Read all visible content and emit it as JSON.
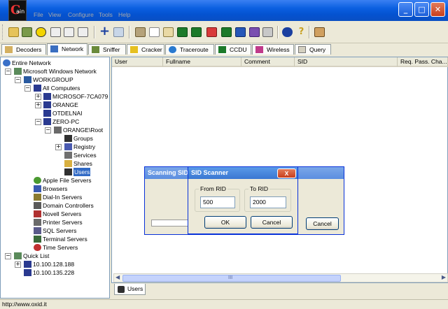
{
  "app": {
    "icon_letter": "C",
    "icon_text": "ain"
  },
  "menu": [
    "File",
    "View",
    "Configure",
    "Tools",
    "Help"
  ],
  "window_buttons": {
    "min": "_",
    "max": "□",
    "close": "✕"
  },
  "toolbar_icons": [
    "open-folder-icon",
    "sniffer-card-icon",
    "radiation-icon",
    "ntlm-auth-icon",
    "challenge-spoof-reset-icon",
    "challenge-spoof-ntlm-icon",
    "add-icon",
    "delete-icon",
    "bruteforce-icon",
    "base64-icon",
    "lsa-icon",
    "network-icon",
    "hash-icon",
    "rdp-icon",
    "cd-icon",
    "cisco-icon",
    "config-icon",
    "info-icon",
    "help-icon",
    "exit-icon"
  ],
  "tabs": [
    "Decoders",
    "Network",
    "Sniffer",
    "Cracker",
    "Traceroute",
    "CCDU",
    "Wireless",
    "Query"
  ],
  "tree": {
    "entire_network": "Entire Network",
    "ms_network": "Microsoft Windows Network",
    "workgroup": "WORKGROUP",
    "all_computers": "All Computers",
    "computers": [
      "MICROSOF-7CA079",
      "ORANGE",
      "OTDELNAI",
      "ZERO-PC"
    ],
    "orange_root": "ORANGE\\Root",
    "root_items": [
      "Groups",
      "Registry",
      "Services",
      "Shares",
      "Users"
    ],
    "servers": [
      "Apple File Servers",
      "Browsers",
      "Dial-In Servers",
      "Domain Controllers",
      "Novell Servers",
      "Printer Servers",
      "SQL Servers",
      "Terminal Servers",
      "Time Servers"
    ],
    "quick_list": "Quick List",
    "quick_items": [
      "10.100.128.188",
      "10.100.135.228"
    ]
  },
  "columns": [
    "User",
    "Fullname",
    "Comment",
    "SID",
    "Req. Pass. Cha..."
  ],
  "bottom_tab": "Users",
  "status": "http://www.oxid.it",
  "scanning_dialog": {
    "title": "Scanning SIDs",
    "cancel": "Cancel"
  },
  "sid_dialog": {
    "title": "SID Scanner",
    "close": "X",
    "from_label": "From RID",
    "from_value": "500",
    "to_label": "To RID",
    "to_value": "2000",
    "ok": "OK",
    "cancel": "Cancel"
  },
  "scroll_grip": "III",
  "colors": {
    "titlebar": "#0a5fe0",
    "selection": "#316ac5",
    "tree_border": "#7f9db9"
  }
}
